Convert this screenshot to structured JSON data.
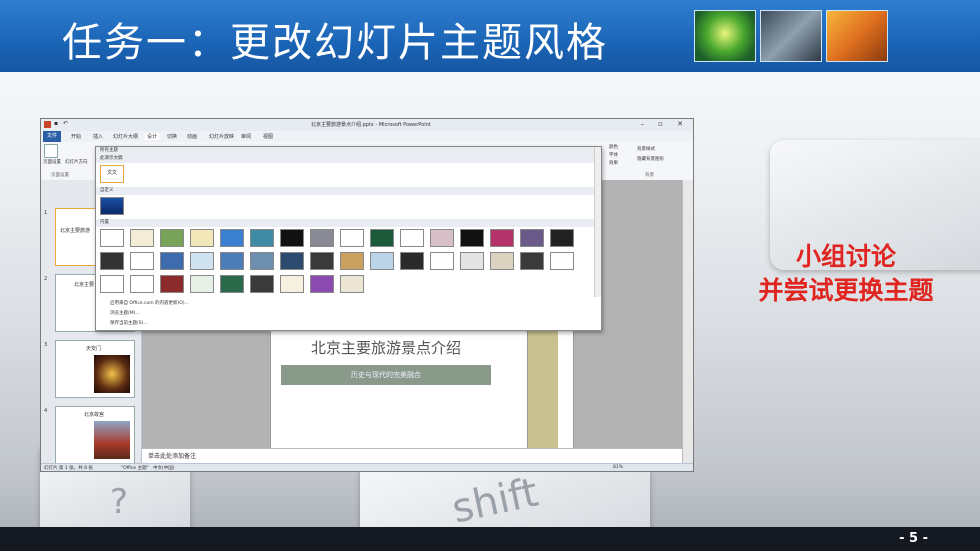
{
  "slide": {
    "title": "任务一：更改幻灯片主题风格",
    "discussion_line1": "小组讨论",
    "discussion_line2": "并尝试更换主题",
    "page_number": "- 5 -",
    "keyboard_key_label": "shift",
    "keyboard_key_label2": "?"
  },
  "powerpoint": {
    "window_title": "北京主要旅游景点介绍.pptx - Microsoft PowerPoint",
    "window_controls": "– ▫ ✕",
    "tabs": [
      "文件",
      "开始",
      "插入",
      "幻灯片大纲",
      "设计",
      "切换",
      "动画",
      "幻灯片放映",
      "审阅",
      "视图"
    ],
    "ribbon": {
      "page_setup": "页面设置",
      "slide_orientation": "幻灯片方向",
      "group_page_setup": "页面设置",
      "colors": "颜色",
      "fonts": "字体",
      "effects": "效果",
      "background_styles": "背景样式",
      "hide_background": "隐藏背景图形",
      "group_background": "背景"
    },
    "gallery": {
      "header_all": "所有主题",
      "section_current": "此演示文稿",
      "section_custom": "自定义",
      "section_builtin": "内置",
      "tile_text": "文文",
      "menu_online": "启用来自 Office.com 的内容更新(O)...",
      "menu_browse": "浏览主题(M)...",
      "menu_save": "保存当前主题(S)..."
    },
    "slides": [
      {
        "num": "1",
        "label": "北京主要旅游"
      },
      {
        "num": "2",
        "label": "北京主要"
      },
      {
        "num": "3",
        "label": "天安门"
      },
      {
        "num": "4",
        "label": "北京故宫"
      }
    ],
    "main_slide": {
      "title": "北京主要旅游景点介绍",
      "subtitle": "历史与现代的完美融合"
    },
    "notes_placeholder": "单击此处添加备注",
    "status": {
      "slide_info": "幻灯片 第 1 张，共 8 张",
      "theme": "\"Office 主题\"",
      "language": "中文(中国)",
      "zoom": "81%"
    }
  },
  "colors": {
    "title_bar": "#1b64b6",
    "accent_red": "#e0241f",
    "bottom_bar": "#151a22"
  }
}
